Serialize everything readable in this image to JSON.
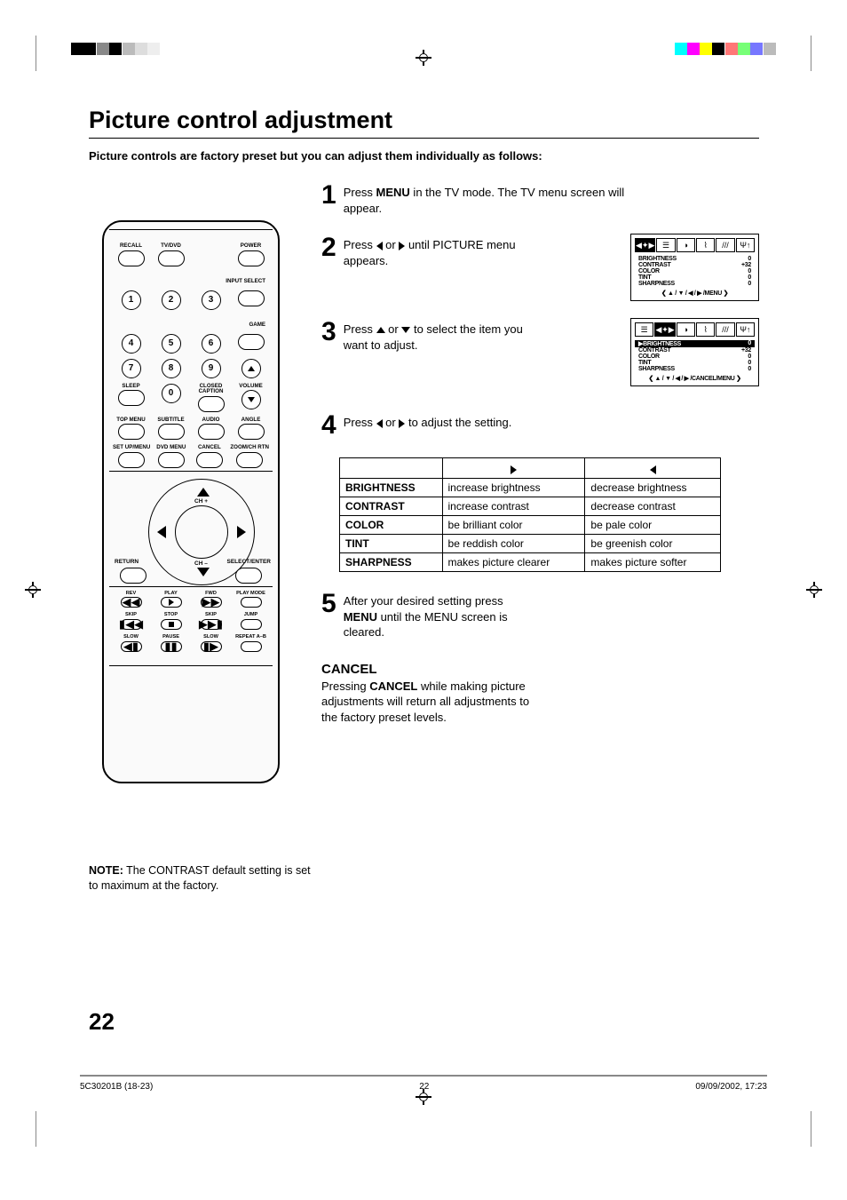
{
  "title": "Picture control adjustment",
  "intro": "Picture controls are factory preset but you can adjust them individually as follows:",
  "remote": {
    "top_row": [
      "RECALL",
      "TV/DVD",
      "",
      "POWER"
    ],
    "input_select": "INPUT SELECT",
    "game": "GAME",
    "numbers_r1": [
      "1",
      "2",
      "3"
    ],
    "numbers_r2": [
      "4",
      "5",
      "6"
    ],
    "numbers_r3": [
      "7",
      "8",
      "9"
    ],
    "zero": "0",
    "sleep": "SLEEP",
    "closed_caption": "CLOSED\nCAPTION",
    "volume": "VOLUME",
    "row_a": [
      "TOP MENU",
      "SUBTITLE",
      "AUDIO",
      "ANGLE"
    ],
    "row_b": [
      "SET UP/MENU",
      "DVD MENU",
      "CANCEL",
      "ZOOM/CH RTN"
    ],
    "dpad": {
      "up": "CH +",
      "down": "CH –",
      "return": "RETURN",
      "select": "SELECT/ENTER"
    },
    "playback": {
      "r1": [
        "REV",
        "PLAY",
        "FWD",
        "PLAY MODE"
      ],
      "r2": [
        "SKIP",
        "STOP",
        "SKIP",
        "JUMP"
      ],
      "r3": [
        "SLOW",
        "PAUSE",
        "SLOW",
        "REPEAT A–B"
      ]
    }
  },
  "steps": {
    "s1_a": "Press ",
    "s1_b": "MENU",
    "s1_c": " in the TV mode. The TV menu screen will appear.",
    "s2_a": "Press ",
    "s2_b": " or ",
    "s2_c": " until PICTURE menu appears.",
    "s3_a": "Press ",
    "s3_b": " or ",
    "s3_c": " to select the item you want to adjust.",
    "s4_a": "Press ",
    "s4_b": " or ",
    "s4_c": " to adjust the setting.",
    "s5_a": "After your desired setting press ",
    "s5_b": "MENU",
    "s5_c": " until the MENU screen is cleared."
  },
  "osd": {
    "rows": [
      {
        "label": "BRIGHTNESS",
        "value": "0"
      },
      {
        "label": "CONTRAST",
        "value": "+32"
      },
      {
        "label": "COLOR",
        "value": "0"
      },
      {
        "label": "TINT",
        "value": "0"
      },
      {
        "label": "SHARPNESS",
        "value": "0"
      }
    ],
    "hint1": "❮ ▲ / ▼ / ◀ / ▶ /MENU ❯",
    "hint2": "❮ ▲ / ▼ / ◀ / ▶ /CANCEL/MENU ❯"
  },
  "table": {
    "rows": [
      {
        "name": "BRIGHTNESS",
        "right": "increase brightness",
        "left": "decrease brightness"
      },
      {
        "name": "CONTRAST",
        "right": "increase contrast",
        "left": "decrease contrast"
      },
      {
        "name": "COLOR",
        "right": "be brilliant color",
        "left": "be pale color"
      },
      {
        "name": "TINT",
        "right": "be reddish color",
        "left": "be greenish color"
      },
      {
        "name": "SHARPNESS",
        "right": "makes picture clearer",
        "left": "makes picture softer"
      }
    ]
  },
  "cancel_h": "CANCEL",
  "cancel_a": "Pressing ",
  "cancel_b": "CANCEL",
  "cancel_c": " while making picture adjustments will return all adjustments to the factory preset levels.",
  "note_h": "NOTE:",
  "note_body": "The CONTRAST default setting is set to maximum at the factory.",
  "page_number": "22",
  "footer": {
    "left": "5C30201B (18-23)",
    "center": "22",
    "right": "09/09/2002, 17:23"
  }
}
